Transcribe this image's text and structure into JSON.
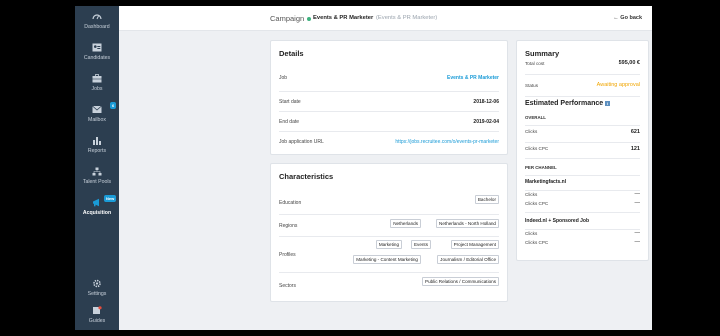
{
  "sidebar": {
    "items": [
      {
        "label": "Dashboard"
      },
      {
        "label": "Candidates"
      },
      {
        "label": "Jobs"
      },
      {
        "label": "Mailbox",
        "badge": "6"
      },
      {
        "label": "Reports"
      },
      {
        "label": "Talent Pools"
      },
      {
        "label": "Acquisition",
        "badge": "New"
      }
    ],
    "bottom": [
      {
        "label": "Settings"
      },
      {
        "label": "Guides"
      }
    ]
  },
  "header": {
    "section": "Campaign",
    "job_title": "Events & PR Marketer",
    "job_subtitle": "(Events & PR Marketer)",
    "back_label": "Go back"
  },
  "details": {
    "title": "Details",
    "rows": [
      {
        "label": "Job",
        "value": "Events & PR Marketer"
      },
      {
        "label": "Start date",
        "value": "2018-12-06"
      },
      {
        "label": "End date",
        "value": "2019-02-04"
      },
      {
        "label": "Job application URL",
        "value": "https://jobs.recruitee.com/o/events-pr-marketer"
      }
    ]
  },
  "characteristics": {
    "title": "Characteristics",
    "education": {
      "label": "Education",
      "tags": [
        "Bachelor"
      ]
    },
    "regions": {
      "label": "Regions",
      "tags": [
        "Netherlands",
        "Netherlands - North Holland"
      ]
    },
    "profiles": {
      "label": "Profiles",
      "tags": [
        "Marketing",
        "Events",
        "Project Management",
        "Marketing - Content Marketing",
        "Journalism / Editorial Office"
      ]
    },
    "sectors": {
      "label": "Sectors",
      "tags": [
        "Public Relations / Communications"
      ]
    }
  },
  "summary": {
    "title": "Summary",
    "total_cost_label": "Total cost",
    "total_cost": "595,00 €",
    "status_label": "Status",
    "status": "Awaiting approval",
    "status_color": "#f0a500",
    "perf_title": "Estimated Performance",
    "overall_label": "OVERALL",
    "clicks_label": "Clicks",
    "clicks": "621",
    "cpc_label": "Clicks CPC",
    "cpc": "121",
    "per_channel_label": "PER CHANNEL",
    "channels": [
      {
        "name": "Marketingfacts.nl",
        "clicks_label": "Clicks",
        "clicks": "—",
        "cpc_label": "Clicks CPC",
        "cpc": "—"
      },
      {
        "name": "Indeed.nl + Sponsored Job",
        "clicks_label": "Clicks",
        "clicks": "—",
        "cpc_label": "Clicks CPC",
        "cpc": "—"
      }
    ]
  }
}
